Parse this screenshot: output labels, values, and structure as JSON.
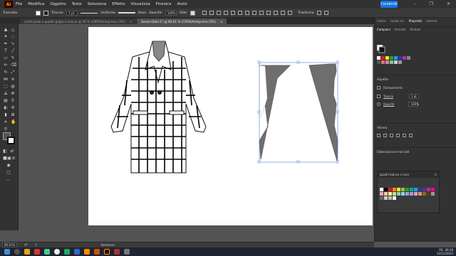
{
  "menubar": {
    "logo": "Ai",
    "items": [
      "File",
      "Modifica",
      "Oggetto",
      "Testo",
      "Seleziona",
      "Effetto",
      "Visualizza",
      "Finestra",
      "Aiuto"
    ],
    "share_label": "Condividi",
    "window_buttons": [
      "–",
      "❐",
      "✕"
    ]
  },
  "control_bar": {
    "mode_label": "Tracciato",
    "stroke_label": "Traccia:",
    "stroke_weight": "1 pt",
    "stroke_profile": "Uniforme",
    "brush": "Base",
    "opacity_label": "Opacità:",
    "opacity_value": "100%",
    "style_label": "Stile:",
    "transform_label": "Trasforma"
  },
  "tabs": [
    {
      "label": "scritti pullo a quadri grigio e rosa.ai @ 50 % (CMYK/Anteprima CPU)",
      "close": "×"
    },
    {
      "label": "Senza titolo-1* @ 80,61 % (CMYK/Anteprima CPU)",
      "close": "×"
    }
  ],
  "panel_tabs_top": [
    "Colore",
    "Guida col.",
    "Proprietà",
    "Libreria"
  ],
  "panel_tabs_sub": [
    "Campioni",
    "Pennelli",
    "Simboli"
  ],
  "properties": {
    "aspect_label": "Aspetto",
    "fill_label": "Riempimento",
    "stroke_label": "Traccia",
    "stroke_value": "1 pt",
    "opacity_label": "Opacità",
    "opacity_value": "100%",
    "align_label": "Allinea",
    "path_edit_label": "Elaborazione tracciati"
  },
  "swatch_library": {
    "title": "quadri bianco e rosa",
    "close": "✕"
  },
  "status_bar": {
    "zoom": "80,61%",
    "angle": "0°",
    "page": "1",
    "mode": "Selezione"
  },
  "taskbar": {
    "lang": "ITA",
    "time": "09:38",
    "date": "22/12/2024"
  },
  "colors": {
    "accent": "#1473e6",
    "shape_fill": "#6e6e6e",
    "selection": "#4f7fd0"
  }
}
